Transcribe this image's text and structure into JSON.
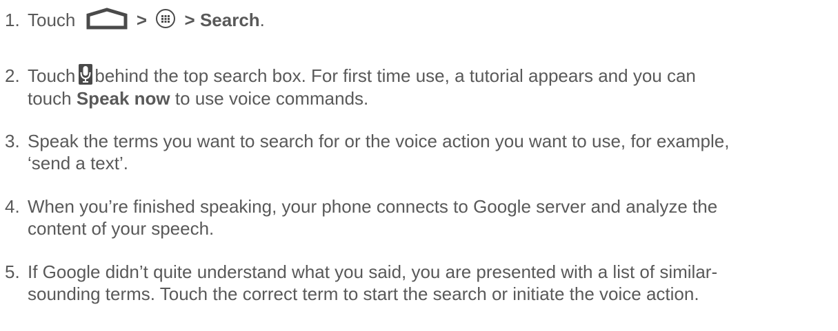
{
  "steps": [
    {
      "number": "1.",
      "touch": "Touch",
      "sep1": ">",
      "sep2": ">",
      "target": "Search",
      "end": ".",
      "icons": [
        "home-icon",
        "all-apps-icon"
      ]
    },
    {
      "number": "2.",
      "touch": "Touch",
      "rest": "behind the top search box. For first time use, a tutorial appears and you can",
      "line2_pre": "touch",
      "line2_bold": "Speak now",
      "line2_post": "to use voice commands.",
      "icons": [
        "microphone-icon"
      ]
    },
    {
      "number": "3.",
      "line1": "Speak the terms you want to search for or the voice action you want to use, for example,",
      "line2": "‘send a text’."
    },
    {
      "number": "4.",
      "line1": "When you’re finished speaking, your phone connects to Google server and analyze the",
      "line2": "content of your speech."
    },
    {
      "number": "5.",
      "line1": "If Google didn’t quite understand what you said, you are presented with a list of similar-",
      "line2": "sounding terms. Touch the correct term to start the search or initiate the voice action."
    }
  ],
  "colors": {
    "text": "#595959",
    "icon": "#4a4a4a"
  }
}
